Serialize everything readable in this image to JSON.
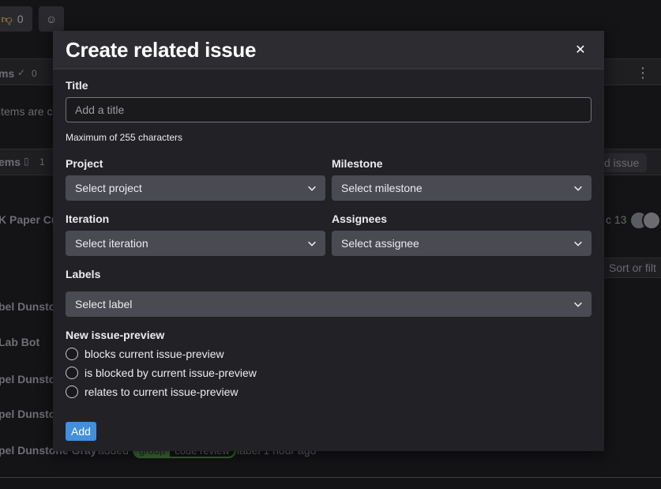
{
  "background": {
    "reaction_thumbs_down_count": "0",
    "items_bar1": "ms",
    "items_bar1_count": "0",
    "items_bar1_desc": "items are c",
    "items_bar2": "ems",
    "items_bar2_count": "1",
    "add_issue_fragment": "d issue",
    "row_paper": "K Paper Cu",
    "row_date": "c 13",
    "sort_fragment": "Sort or filt",
    "names": [
      "bel Dunsto",
      "Lab Bot",
      "pel Dunsto",
      "pel Dunsto",
      "pel Dunstone Gray"
    ],
    "activity_text_added": "added",
    "label_scope": "group",
    "label_value": "code review",
    "activity_time": "label 1 hour ago"
  },
  "modal": {
    "title": "Create related issue",
    "title_field": {
      "label": "Title",
      "placeholder": "Add a title",
      "hint": "Maximum of 255 characters"
    },
    "project": {
      "label": "Project",
      "value": "Select project"
    },
    "milestone": {
      "label": "Milestone",
      "value": "Select milestone"
    },
    "iteration": {
      "label": "Iteration",
      "value": "Select iteration"
    },
    "assignees": {
      "label": "Assignees",
      "value": "Select assignee"
    },
    "labels": {
      "label": "Labels",
      "value": "Select label"
    },
    "relation": {
      "label": "New issue-preview",
      "options": [
        "blocks current issue-preview",
        "is blocked by current issue-preview",
        "relates to current issue-preview"
      ]
    },
    "add_button": "Add"
  },
  "colors": {
    "modal_bg": "#222226",
    "header_bg": "#2d2d31",
    "select_bg": "#4a4a52",
    "primary": "#428fdc"
  }
}
